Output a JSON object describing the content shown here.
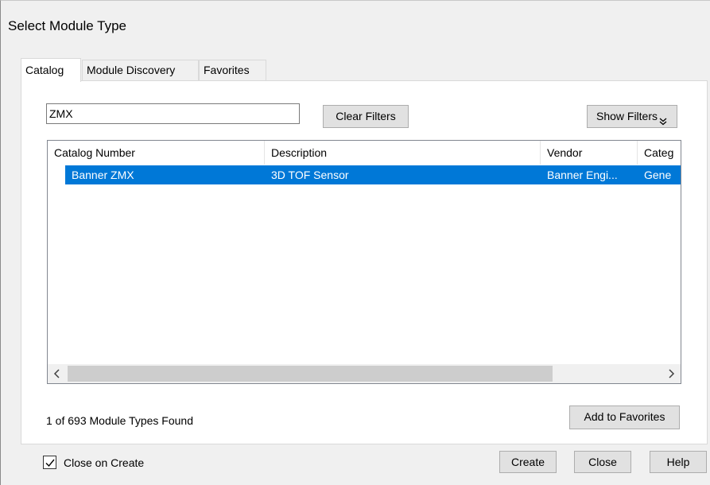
{
  "dialog": {
    "title": "Select Module Type"
  },
  "tabs": [
    {
      "label": "Catalog",
      "active": true
    },
    {
      "label": "Module Discovery",
      "active": false
    },
    {
      "label": "Favorites",
      "active": false
    }
  ],
  "filter": {
    "value": "ZMX",
    "placeholder": ""
  },
  "buttons": {
    "clear_filters": "Clear Filters",
    "show_filters": "Show Filters",
    "show_filters_icon": "double-chevron-down-icon",
    "add_favorites": "Add to Favorites",
    "create": "Create",
    "close": "Close",
    "help": "Help"
  },
  "list": {
    "columns": [
      "Catalog Number",
      "Description",
      "Vendor",
      "Categ"
    ],
    "rows": [
      {
        "catalog_number": "Banner ZMX",
        "description": "3D TOF Sensor",
        "vendor": "Banner Engi...",
        "category": "Gene",
        "selected": true
      }
    ],
    "scroll_left_icon": "chevron-left-icon",
    "scroll_right_icon": "chevron-right-icon"
  },
  "status": "1 of 693 Module Types Found",
  "close_on_create": {
    "label": "Close on Create",
    "checked": true
  },
  "colors": {
    "selection": "#0078d7",
    "dialog_bg": "#f0f0f0",
    "button_bg": "#e1e1e1"
  }
}
